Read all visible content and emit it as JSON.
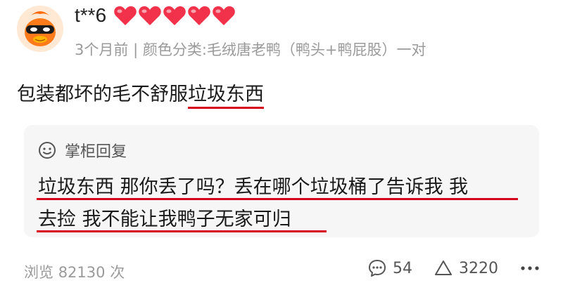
{
  "user": {
    "name": "t**6",
    "avatar_icon": "orange-masked-duck-avatar-icon",
    "heart_count": 5,
    "heart_color": "#f2324a"
  },
  "meta": {
    "time": "3个月前",
    "separator": "|",
    "variant": "颜色分类:毛绒唐老鸭（鸭头+鸭屁股）一对"
  },
  "review": {
    "text_before": "包装都坏的毛不舒服",
    "text_underlined": "垃圾东西"
  },
  "reply": {
    "label": "掌柜回复",
    "icon": "smiley-face-icon",
    "line1": "垃圾东西 那你丢了吗？丢在哪个垃圾桶了告诉我 我",
    "line2": "去捡 我不能让我鸭子无家可归"
  },
  "stats": {
    "views_label": "浏览",
    "views_count": "82130",
    "views_unit": "次",
    "comments": "54",
    "likes": "3220",
    "more_icon": "more-horizontal-icon"
  },
  "colors": {
    "underline": "#d6001c",
    "meta_text": "#9a9a9a",
    "reply_bg": "#f6f6f6"
  }
}
